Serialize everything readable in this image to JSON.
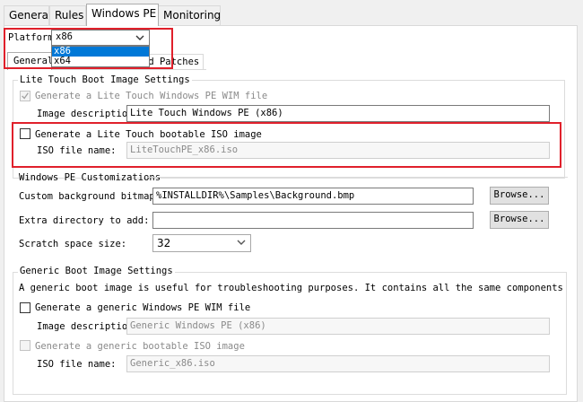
{
  "tabs": [
    "General",
    "Rules",
    "Windows PE",
    "Monitoring"
  ],
  "platform": {
    "label": "Platform:",
    "selected": "x86",
    "options": [
      "x86",
      "x64"
    ]
  },
  "subtabs": {
    "general": "General",
    "features_partial": "nd Patches"
  },
  "lite_touch_wim": {
    "legend": "Lite Touch Boot Image Settings",
    "generate_label": "Generate a Lite Touch Windows PE WIM file",
    "image_desc_label": "Image description:",
    "image_desc_value": "Lite Touch Windows PE (x86)"
  },
  "lite_touch_iso": {
    "generate_label": "Generate a Lite Touch bootable ISO image",
    "iso_name_label": "ISO file name:",
    "iso_name_value": "LiteTouchPE_x86.iso"
  },
  "customizations": {
    "legend": "Windows PE Customizations",
    "bitmap_label": "Custom background bitmap fi",
    "bitmap_value": "%INSTALLDIR%\\Samples\\Background.bmp",
    "browse1": "Browse...",
    "extra_dir_label": "Extra directory to add:",
    "extra_dir_value": "",
    "browse2": "Browse...",
    "scratch_label": "Scratch space size:",
    "scratch_value": "32"
  },
  "generic": {
    "legend": "Generic Boot Image Settings",
    "description": "A generic boot image is useful for troubleshooting purposes.  It contains all the same components and drivers,",
    "generate_wim_label": "Generate a generic Windows PE WIM file",
    "image_desc_label": "Image description:",
    "image_desc_value": "Generic Windows PE (x86)",
    "generate_iso_label": "Generate a generic bootable ISO image",
    "iso_name_label": "ISO file name:",
    "iso_name_value": "Generic_x86.iso"
  },
  "colors": {
    "highlight_red": "#e0202b",
    "selection_blue": "#0078d7"
  }
}
